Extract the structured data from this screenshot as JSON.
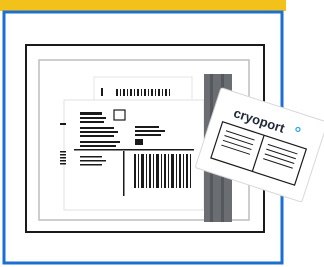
{
  "colors": {
    "frame_border": "#1a6fd1",
    "top_banner": "#f2c21a",
    "ink": "#1a1a1a",
    "strap": "#5f6266",
    "logo_accent": "#29a7e1"
  },
  "icons": [
    "shipping-label-icon",
    "barcode-icon",
    "cryoport-tag-icon",
    "strap-icon"
  ],
  "tag": {
    "brand_text": "cryoport"
  }
}
